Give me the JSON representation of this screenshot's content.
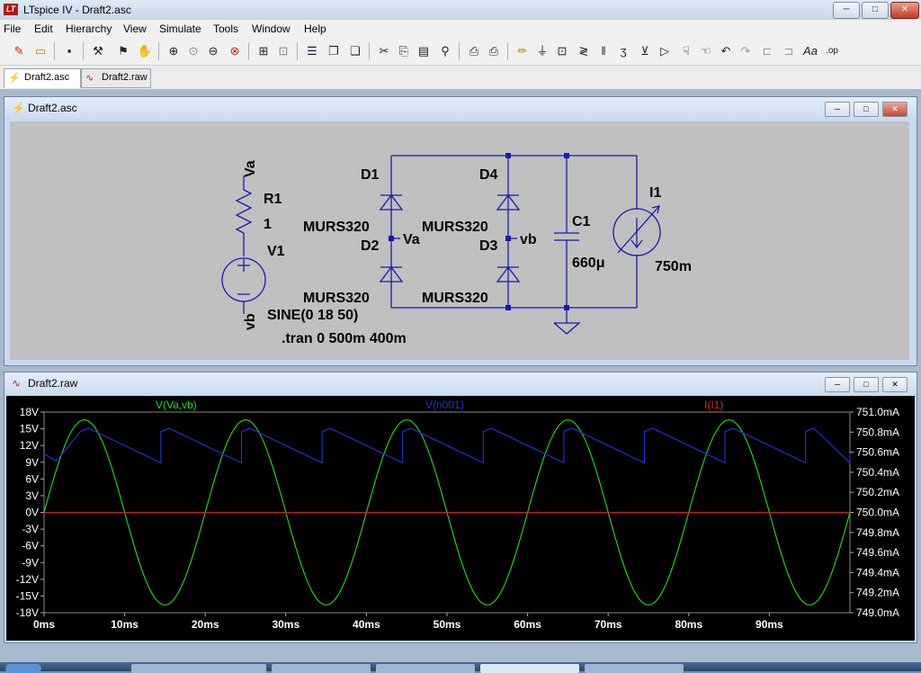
{
  "app": {
    "title": "LTspice IV - Draft2.asc",
    "icon": "LT"
  },
  "window_controls": {
    "minimize": "─",
    "maximize": "□",
    "close": "✕"
  },
  "menu": [
    "File",
    "Edit",
    "Hierarchy",
    "View",
    "Simulate",
    "Tools",
    "Window",
    "Help"
  ],
  "tabs": [
    {
      "label": "Draft2.asc",
      "icon": "schematic-icon"
    },
    {
      "label": "Draft2.raw",
      "icon": "waveform-icon"
    }
  ],
  "schematic_window": {
    "title": "Draft2.asc",
    "components": {
      "r1_name": "R1",
      "r1_value": "1",
      "v1_name": "V1",
      "v1_value": "SINE(0 18 50)",
      "d1_name": "D1",
      "d1_model": "MURS320",
      "d2_name": "D2",
      "d2_model": "MURS320",
      "d3_name": "D3",
      "d3_model": "MURS320",
      "d4_name": "D4",
      "d4_model": "MURS320",
      "c1_name": "C1",
      "c1_value": "660μ",
      "i1_name": "I1",
      "i1_value": "750m"
    },
    "nets": {
      "va": "Va",
      "vb": "vb"
    },
    "directive": ".tran 0 500m 400m"
  },
  "waveform_window": {
    "title": "Draft2.raw",
    "traces": [
      {
        "label": "V(Va,vb)",
        "color": "#22dd22"
      },
      {
        "label": "V(n001)",
        "color": "#2233dd"
      },
      {
        "label": "I(I1)",
        "color": "#dd2222"
      }
    ]
  },
  "chart_data": {
    "type": "line",
    "x_unit": "ms",
    "xlim": [
      0,
      100
    ],
    "x_ticks": [
      "0ms",
      "10ms",
      "20ms",
      "30ms",
      "40ms",
      "50ms",
      "60ms",
      "70ms",
      "80ms",
      "90ms"
    ],
    "y_left_ticks": [
      "18V",
      "15V",
      "12V",
      "9V",
      "6V",
      "3V",
      "0V",
      "-3V",
      "-6V",
      "-9V",
      "-12V",
      "-15V",
      "-18V"
    ],
    "y_left_lim": [
      -18,
      18
    ],
    "y_right_ticks": [
      "751.0mA",
      "750.8mA",
      "750.6mA",
      "750.4mA",
      "750.2mA",
      "750.0mA",
      "749.8mA",
      "749.6mA",
      "749.4mA",
      "749.2mA",
      "749.0mA"
    ],
    "y_right_lim": [
      749.0,
      751.0
    ],
    "series": [
      {
        "name": "V(Va,vb)",
        "color": "#22dd22",
        "axis": "left",
        "model": {
          "kind": "clipped_sine",
          "amplitude": 16.6,
          "clip": 10.0,
          "period_ms": 20,
          "phase_ms": 0
        }
      },
      {
        "name": "V(n001)",
        "color": "#2233dd",
        "axis": "left",
        "model": {
          "kind": "ripple",
          "peak": 15.1,
          "trough": 8.9,
          "peak_times_ms": [
            5.5,
            15.5,
            25.5,
            35.5,
            45.5,
            55.5,
            65.5,
            75.5,
            85.5,
            95.5
          ]
        }
      },
      {
        "name": "I(I1)",
        "color": "#dd2222",
        "axis": "right",
        "model": {
          "kind": "constant",
          "value": 750.0
        }
      }
    ]
  }
}
